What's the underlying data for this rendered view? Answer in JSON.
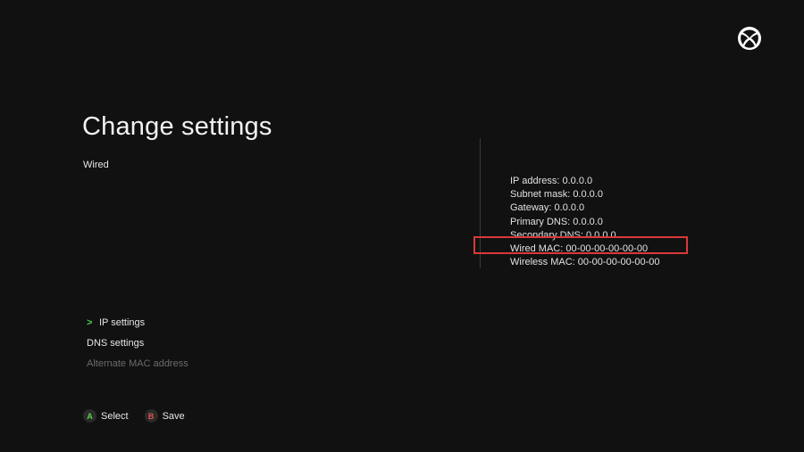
{
  "header": {
    "title": "Change settings",
    "subtitle": "Wired",
    "logo_icon": "xbox-logo-icon"
  },
  "network_info": {
    "rows": [
      "IP address: 0.0.0.0",
      "Subnet mask: 0.0.0.0",
      "Gateway: 0.0.0.0",
      "Primary DNS: 0.0.0.0",
      "Secondary DNS: 0.0.0.0",
      "Wired MAC: 00-00-00-00-00-00",
      "Wireless MAC: 00-00-00-00-00-00"
    ],
    "highlight_color": "#d9393a"
  },
  "menu": {
    "items": [
      {
        "label": "IP settings",
        "selected": true,
        "enabled": true
      },
      {
        "label": "DNS settings",
        "selected": false,
        "enabled": true
      },
      {
        "label": "Alternate MAC address",
        "selected": false,
        "enabled": false
      }
    ],
    "selected_indicator_color": "#4fcf4f"
  },
  "button_hints": {
    "a": {
      "glyph": "A",
      "label": "Select",
      "color": "#5fcf4f"
    },
    "b": {
      "glyph": "B",
      "label": "Save",
      "color": "#e05050"
    }
  }
}
